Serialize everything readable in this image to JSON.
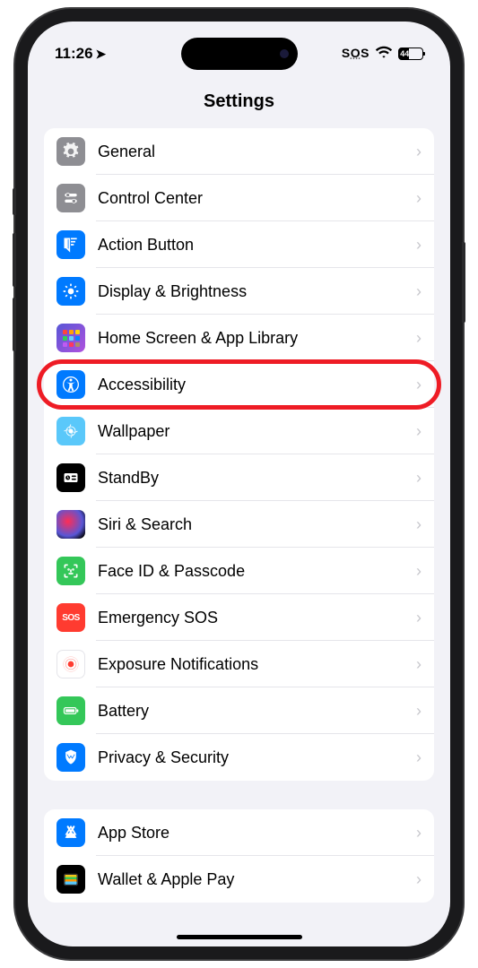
{
  "status": {
    "time": "11:26",
    "sos": "SOS",
    "battery": "44"
  },
  "header": {
    "title": "Settings"
  },
  "groups": [
    {
      "items": [
        {
          "label": "General",
          "icon": "general"
        },
        {
          "label": "Control Center",
          "icon": "control-center"
        },
        {
          "label": "Action Button",
          "icon": "action-button"
        },
        {
          "label": "Display & Brightness",
          "icon": "display"
        },
        {
          "label": "Home Screen & App Library",
          "icon": "home-screen"
        },
        {
          "label": "Accessibility",
          "icon": "accessibility",
          "highlighted": true
        },
        {
          "label": "Wallpaper",
          "icon": "wallpaper"
        },
        {
          "label": "StandBy",
          "icon": "standby"
        },
        {
          "label": "Siri & Search",
          "icon": "siri"
        },
        {
          "label": "Face ID & Passcode",
          "icon": "faceid"
        },
        {
          "label": "Emergency SOS",
          "icon": "sos"
        },
        {
          "label": "Exposure Notifications",
          "icon": "exposure"
        },
        {
          "label": "Battery",
          "icon": "battery"
        },
        {
          "label": "Privacy & Security",
          "icon": "privacy"
        }
      ]
    },
    {
      "items": [
        {
          "label": "App Store",
          "icon": "appstore"
        },
        {
          "label": "Wallet & Apple Pay",
          "icon": "wallet"
        }
      ]
    }
  ],
  "icon_colors": {
    "general": "bg-gray",
    "control-center": "bg-gray",
    "action-button": "bg-blue",
    "display": "bg-blue",
    "home-screen": "bg-purple",
    "accessibility": "bg-blue",
    "wallpaper": "bg-cyan",
    "standby": "bg-black",
    "siri": "bg-siri",
    "faceid": "bg-green",
    "sos": "bg-red",
    "exposure": "bg-white",
    "battery": "bg-green",
    "privacy": "bg-blue",
    "appstore": "bg-blue",
    "wallet": "bg-black"
  },
  "sos_label": "SOS"
}
